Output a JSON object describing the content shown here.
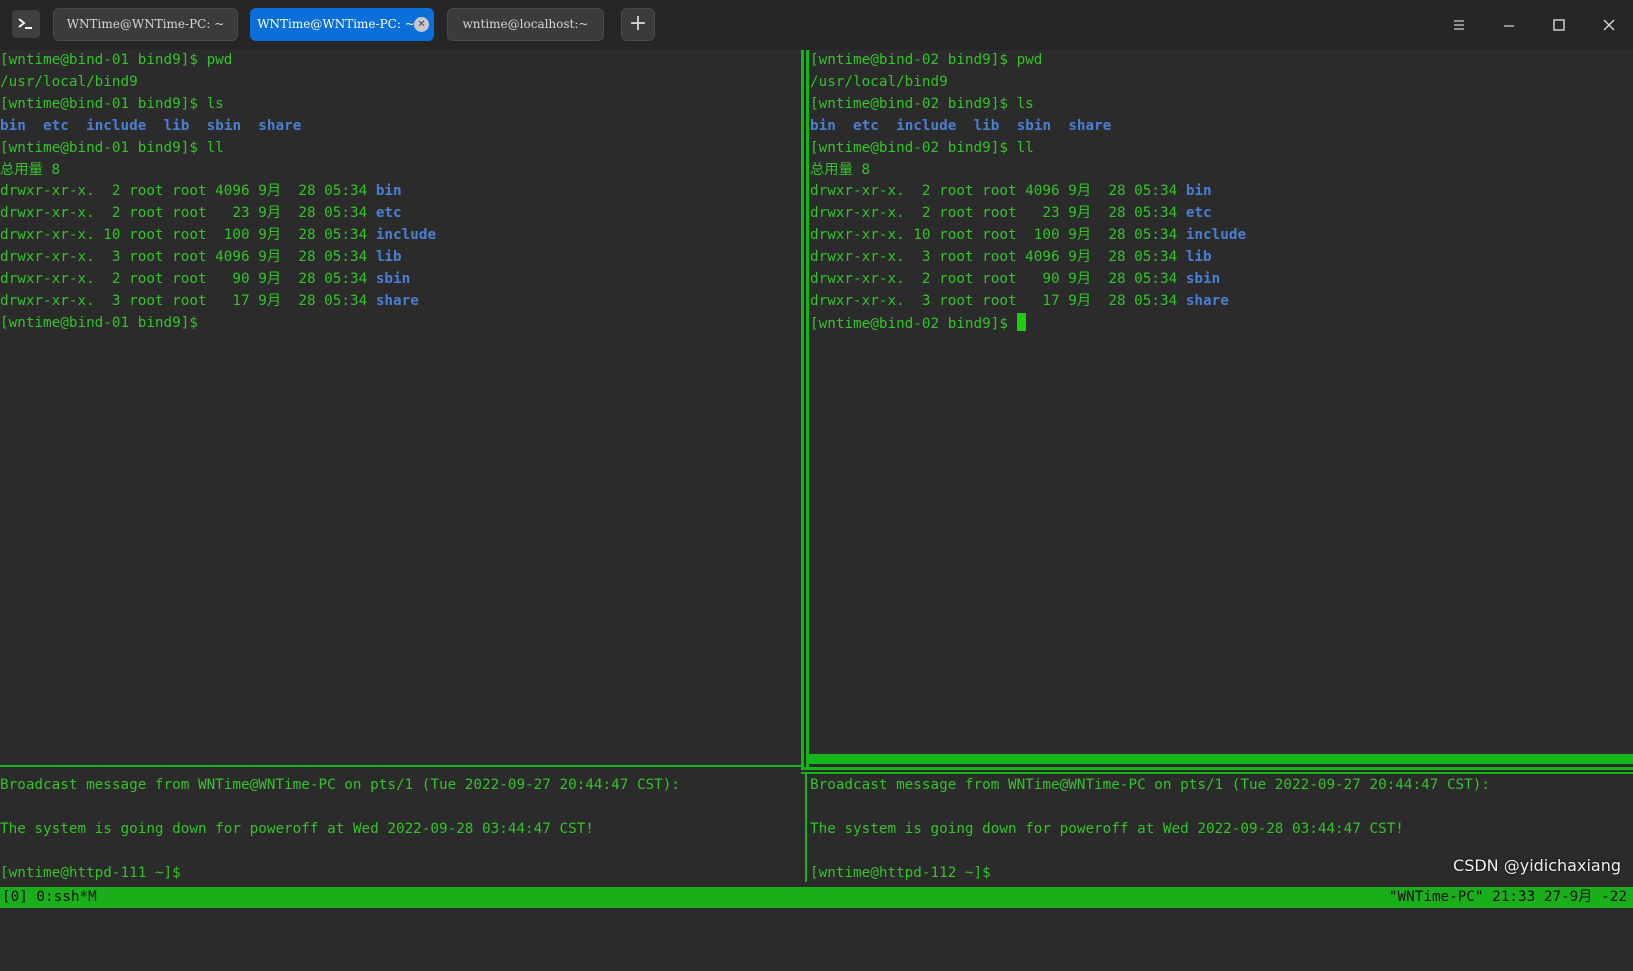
{
  "tabs": [
    {
      "label": "WNTime@WNTime-PC: ~",
      "active": false
    },
    {
      "label": "WNTime@WNTime-PC: ~",
      "active": true
    },
    {
      "label": "wntime@localhost:~",
      "active": false
    }
  ],
  "panes": {
    "top_left": {
      "lines": [
        [
          {
            "t": "[wntime@bind-01 bind9]$ pwd"
          }
        ],
        [
          {
            "t": "/usr/local/bind9"
          }
        ],
        [
          {
            "t": "[wntime@bind-01 bind9]$ ls"
          }
        ],
        [
          {
            "t": "bin",
            "c": "dir"
          },
          {
            "t": "  "
          },
          {
            "t": "etc",
            "c": "dir"
          },
          {
            "t": "  "
          },
          {
            "t": "include",
            "c": "dir"
          },
          {
            "t": "  "
          },
          {
            "t": "lib",
            "c": "dir"
          },
          {
            "t": "  "
          },
          {
            "t": "sbin",
            "c": "dir"
          },
          {
            "t": "  "
          },
          {
            "t": "share",
            "c": "dir"
          }
        ],
        [
          {
            "t": "[wntime@bind-01 bind9]$ ll"
          }
        ],
        [
          {
            "t": "总用量 8"
          }
        ],
        [
          {
            "t": "drwxr-xr-x.  2 root root 4096 9月  28 05:34 "
          },
          {
            "t": "bin",
            "c": "dir"
          }
        ],
        [
          {
            "t": "drwxr-xr-x.  2 root root   23 9月  28 05:34 "
          },
          {
            "t": "etc",
            "c": "dir"
          }
        ],
        [
          {
            "t": "drwxr-xr-x. 10 root root  100 9月  28 05:34 "
          },
          {
            "t": "include",
            "c": "dir"
          }
        ],
        [
          {
            "t": "drwxr-xr-x.  3 root root 4096 9月  28 05:34 "
          },
          {
            "t": "lib",
            "c": "dir"
          }
        ],
        [
          {
            "t": "drwxr-xr-x.  2 root root   90 9月  28 05:34 "
          },
          {
            "t": "sbin",
            "c": "dir"
          }
        ],
        [
          {
            "t": "drwxr-xr-x.  3 root root   17 9月  28 05:34 "
          },
          {
            "t": "share",
            "c": "dir"
          }
        ],
        [
          {
            "t": "[wntime@bind-01 bind9]$ "
          }
        ]
      ]
    },
    "top_right": {
      "lines": [
        [
          {
            "t": "[wntime@bind-02 bind9]$ pwd"
          }
        ],
        [
          {
            "t": "/usr/local/bind9"
          }
        ],
        [
          {
            "t": "[wntime@bind-02 bind9]$ ls"
          }
        ],
        [
          {
            "t": "bin",
            "c": "dir"
          },
          {
            "t": "  "
          },
          {
            "t": "etc",
            "c": "dir"
          },
          {
            "t": "  "
          },
          {
            "t": "include",
            "c": "dir"
          },
          {
            "t": "  "
          },
          {
            "t": "lib",
            "c": "dir"
          },
          {
            "t": "  "
          },
          {
            "t": "sbin",
            "c": "dir"
          },
          {
            "t": "  "
          },
          {
            "t": "share",
            "c": "dir"
          }
        ],
        [
          {
            "t": "[wntime@bind-02 bind9]$ ll"
          }
        ],
        [
          {
            "t": "总用量 8"
          }
        ],
        [
          {
            "t": "drwxr-xr-x.  2 root root 4096 9月  28 05:34 "
          },
          {
            "t": "bin",
            "c": "dir"
          }
        ],
        [
          {
            "t": "drwxr-xr-x.  2 root root   23 9月  28 05:34 "
          },
          {
            "t": "etc",
            "c": "dir"
          }
        ],
        [
          {
            "t": "drwxr-xr-x. 10 root root  100 9月  28 05:34 "
          },
          {
            "t": "include",
            "c": "dir"
          }
        ],
        [
          {
            "t": "drwxr-xr-x.  3 root root 4096 9月  28 05:34 "
          },
          {
            "t": "lib",
            "c": "dir"
          }
        ],
        [
          {
            "t": "drwxr-xr-x.  2 root root   90 9月  28 05:34 "
          },
          {
            "t": "sbin",
            "c": "dir"
          }
        ],
        [
          {
            "t": "drwxr-xr-x.  3 root root   17 9月  28 05:34 "
          },
          {
            "t": "share",
            "c": "dir"
          }
        ],
        [
          {
            "t": "[wntime@bind-02 bind9]$ "
          },
          {
            "c": "cursor"
          }
        ]
      ]
    },
    "bottom_left": {
      "lines": [
        [
          {
            "t": "Broadcast message from WNTime@WNTime-PC on pts/1 (Tue 2022-09-27 20:44:47 CST):"
          }
        ],
        [
          {
            "t": ""
          }
        ],
        [
          {
            "t": "The system is going down for poweroff at Wed 2022-09-28 03:44:47 CST!"
          }
        ],
        [
          {
            "t": ""
          }
        ],
        [
          {
            "t": "[wntime@httpd-111 ~]$"
          }
        ]
      ]
    },
    "bottom_right": {
      "lines": [
        [
          {
            "t": "Broadcast message from WNTime@WNTime-PC on pts/1 (Tue 2022-09-27 20:44:47 CST):"
          }
        ],
        [
          {
            "t": ""
          }
        ],
        [
          {
            "t": "The system is going down for poweroff at Wed 2022-09-28 03:44:47 CST!"
          }
        ],
        [
          {
            "t": ""
          }
        ],
        [
          {
            "t": "[wntime@httpd-112 ~]$"
          }
        ]
      ]
    }
  },
  "statusbar": {
    "left": "[0] 0:ssh*M",
    "right": "\"WNTime-PC\" 21:33 27-9月 -22"
  },
  "watermark": "CSDN @yidichaxiang",
  "icons": {
    "app": "terminal-icon",
    "add_tab": "plus-icon",
    "close_tab": "close-icon",
    "menu": "hamburger-menu-icon",
    "minimize": "minimize-icon",
    "maximize": "maximize-icon",
    "close_window": "close-icon"
  },
  "colors": {
    "terminal_text": "#35c22a",
    "directory": "#4a7fd4",
    "pane_border": "#16b51a",
    "statusbar": "#1aaf1a",
    "active_tab": "#0a6fd8",
    "background": "#2b2b2b"
  }
}
